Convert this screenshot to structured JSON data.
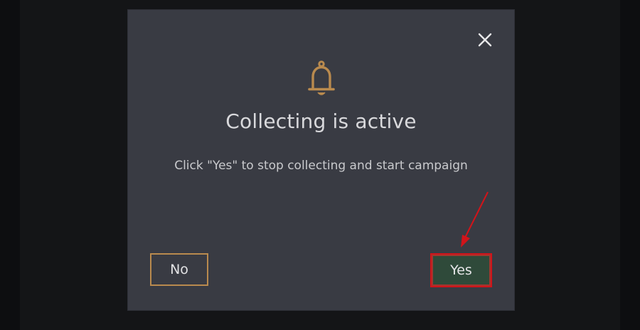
{
  "dialog": {
    "title": "Collecting is active",
    "message": "Click \"Yes\" to stop collecting and start campaign",
    "no_label": "No",
    "yes_label": "Yes",
    "icons": {
      "bell": "bell-icon",
      "close": "close-icon"
    }
  },
  "colors": {
    "modal_bg": "#393b43",
    "accent_gold": "#b98a4e",
    "yes_bg": "#2f4a3a",
    "annotation_red": "#d1141a"
  }
}
